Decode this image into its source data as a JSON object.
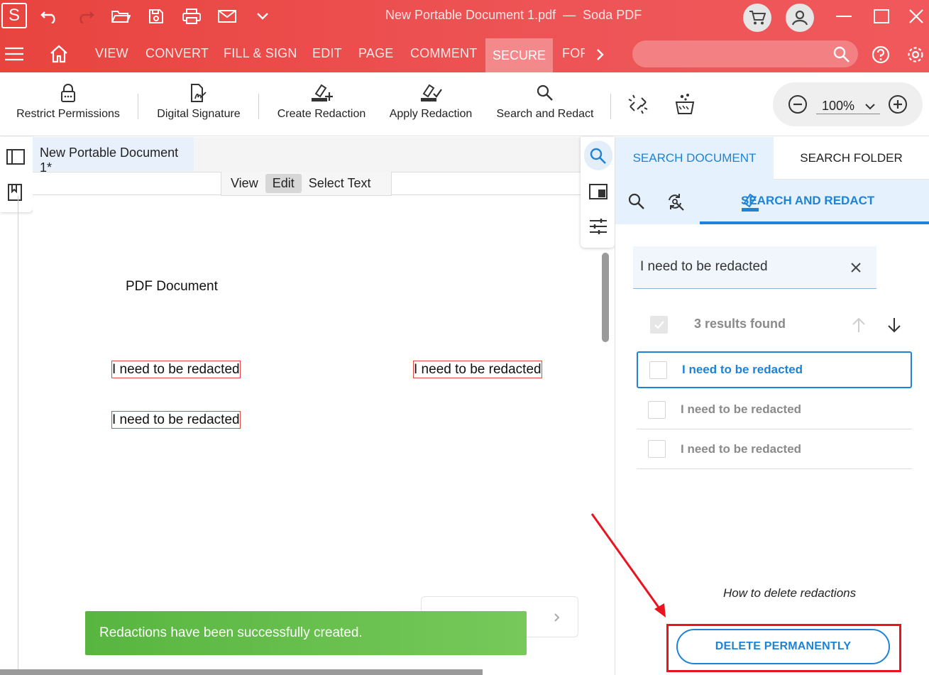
{
  "window": {
    "title": "New Portable Document 1.pdf",
    "separator": "—",
    "app_name": "Soda PDF",
    "logo_letter": "S"
  },
  "menu": {
    "items": [
      "VIEW",
      "CONVERT",
      "FILL & SIGN",
      "EDIT",
      "PAGE",
      "COMMENT",
      "SECURE",
      "FOF"
    ],
    "active": "SECURE"
  },
  "ribbon": {
    "restrict_permissions": "Restrict Permissions",
    "digital_signature": "Digital Signature",
    "create_redaction": "Create Redaction",
    "apply_redaction": "Apply Redaction",
    "search_and_redact": "Search and Redact",
    "zoom": "100%"
  },
  "document": {
    "tab_title": "New Portable Document 1*",
    "modes": [
      "View",
      "Edit",
      "Select Text"
    ],
    "active_mode": "Edit",
    "heading": "PDF Document",
    "redacted_text": "I need to be redacted"
  },
  "toast": "Redactions have been successfully created.",
  "panel": {
    "tab_search_document": "SEARCH DOCUMENT",
    "tab_search_folder": "SEARCH FOLDER",
    "sub_tab_active": "SEARCH AND REDACT",
    "search_value": "I need to be redacted",
    "results_count": "3 results found",
    "results": [
      "I need to be redacted",
      "I need to be redacted",
      "I need to be redacted"
    ],
    "how_to": "How to delete redactions",
    "delete_button": "DELETE PERMANENTLY"
  },
  "colors": {
    "brand_red": "#ee5456",
    "accent_blue": "#1e83d6",
    "toast_green": "#62bd4a",
    "annotation_red": "#e8141e"
  }
}
